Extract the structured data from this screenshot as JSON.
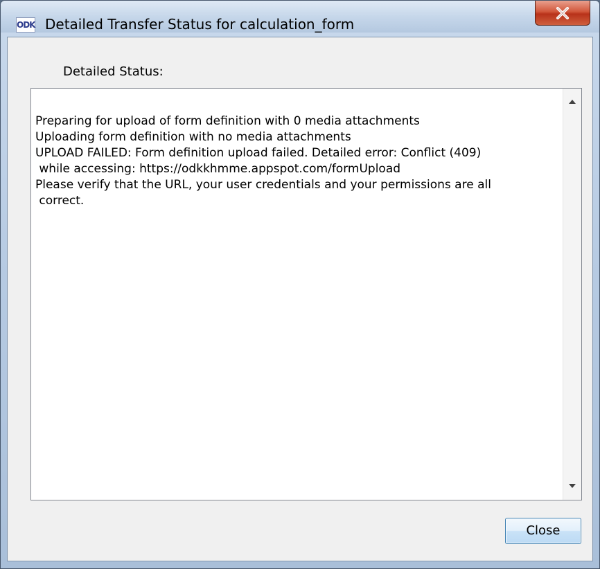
{
  "window": {
    "title": "Detailed Transfer Status for calculation_form",
    "app_icon_text": "ODK",
    "app_icon": "odk-logo-icon",
    "close_icon": "close-icon"
  },
  "status": {
    "label": "Detailed Status:",
    "lines": [
      "Preparing for upload of form definition with 0 media attachments",
      "Uploading form definition with no media attachments",
      "UPLOAD FAILED: Form definition upload failed.  Detailed error: Conflict (409)",
      " while accessing: https://odkkhmme.appspot.com/formUpload",
      "Please verify that the URL, your user credentials and your permissions are all",
      " correct."
    ]
  },
  "scrollbar": {
    "up_icon": "scroll-up-arrow-icon",
    "down_icon": "scroll-down-arrow-icon"
  },
  "buttons": {
    "close_label": "Close"
  },
  "colors": {
    "close_accent": "#c9401f",
    "button_border": "#3c7fb1",
    "client_background": "#f0f0f0"
  }
}
